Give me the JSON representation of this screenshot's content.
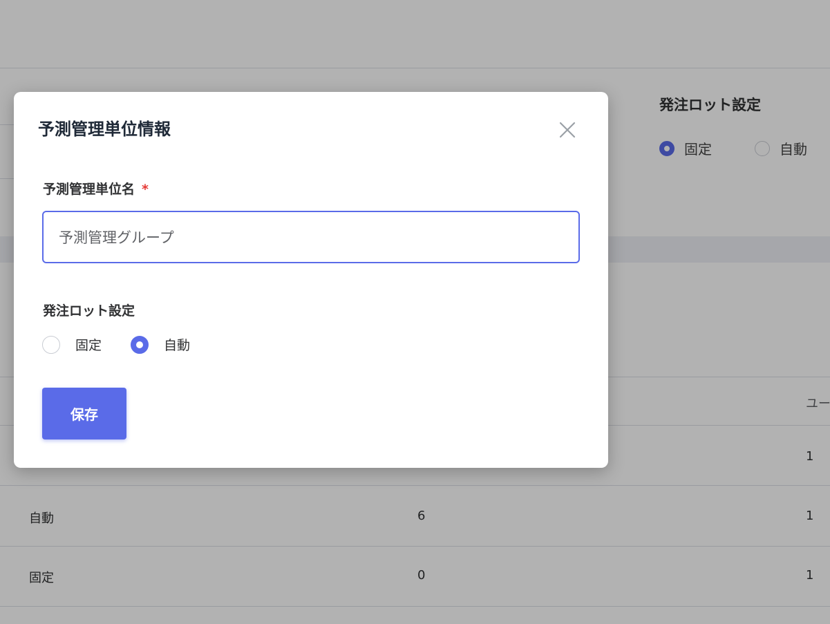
{
  "background": {
    "lot_setting_title": "発注ロット設定",
    "lot_options": [
      {
        "label": "固定",
        "selected": true
      },
      {
        "label": "自動",
        "selected": false
      }
    ],
    "table_header_partial": "ユー",
    "rows": [
      {
        "type": "",
        "count": "",
        "last": "1"
      },
      {
        "type": "自動",
        "count": "6",
        "last": "1"
      },
      {
        "type": "固定",
        "count": "0",
        "last": "1"
      }
    ]
  },
  "modal": {
    "title": "予測管理単位情報",
    "close_icon": "close-icon",
    "name_field": {
      "label": "予測管理単位名",
      "required_mark": "*",
      "value": "予測管理グループ"
    },
    "lot_setting": {
      "label": "発注ロット設定",
      "options": [
        {
          "label": "固定",
          "selected": false
        },
        {
          "label": "自動",
          "selected": true
        }
      ]
    },
    "save_label": "保存"
  },
  "colors": {
    "accent": "#5a6be8",
    "required": "#e53935",
    "overlay": "rgba(0,0,0,0.30)"
  }
}
